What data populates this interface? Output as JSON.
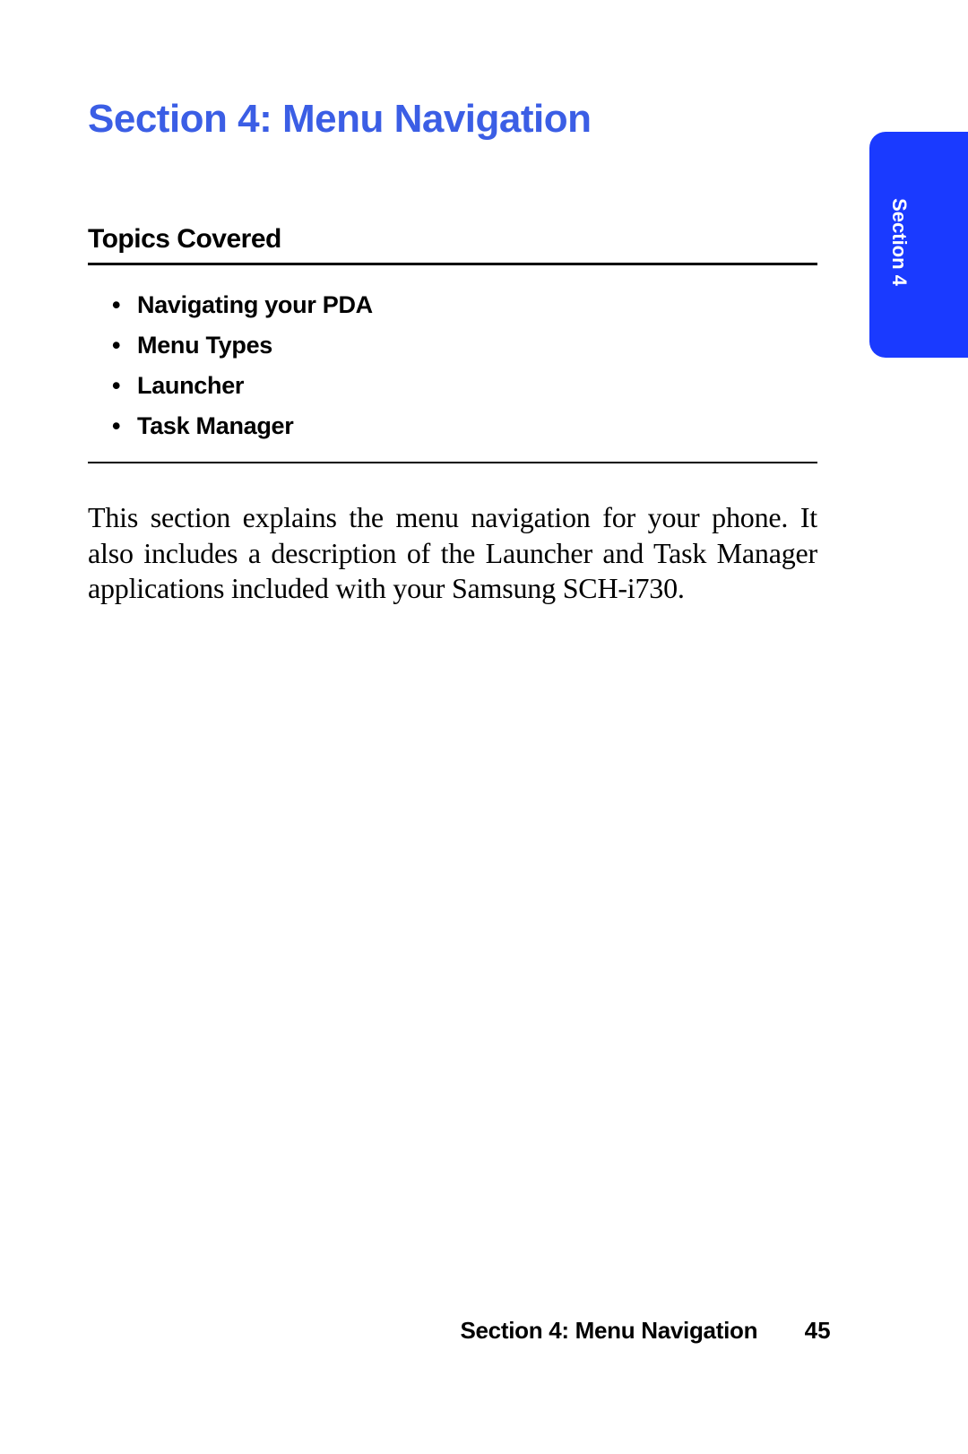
{
  "header": {
    "section_title": "Section 4: Menu Navigation"
  },
  "side_tab": {
    "label": "Section 4"
  },
  "topics": {
    "heading": "Topics Covered",
    "items": [
      "Navigating your PDA",
      "Menu Types",
      "Launcher",
      "Task Manager"
    ]
  },
  "body": {
    "paragraph": "This section explains the menu navigation for your phone. It also includes a description of the Launcher and Task Manager applications included with your Samsung SCH-i730."
  },
  "footer": {
    "section_label": "Section 4: Menu Navigation",
    "page_number": "45"
  }
}
